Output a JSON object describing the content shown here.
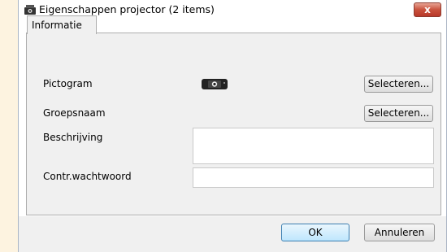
{
  "window": {
    "title": "Eigenschappen projector (2 items)",
    "close_label": "x"
  },
  "tabs": [
    {
      "label": "Informatie"
    }
  ],
  "form": {
    "icon_label": "Pictogram",
    "group_label": "Groepsnaam",
    "description_label": "Beschrijving",
    "password_label": "Contr.wachtwoord",
    "select_button_label": "Selecteren...",
    "description_value": "",
    "password_value": ""
  },
  "footer": {
    "ok_label": "OK",
    "cancel_label": "Annuleren"
  },
  "colors": {
    "background": "#fdf3e0",
    "panel": "#f0f0f0",
    "close_button": "#c9523d",
    "ok_button_border": "#3c7fb1"
  },
  "icons": {
    "app": "projector-icon",
    "pictogram": "projector-icon",
    "close": "close-icon"
  }
}
